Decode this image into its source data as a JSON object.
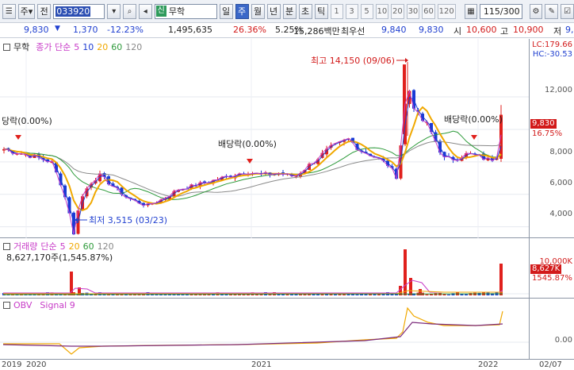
{
  "toolbar": {
    "menu_icon": "list-icon",
    "type_label": "주",
    "dropdown_label": "전",
    "code": "033920",
    "search_icon": "search-icon",
    "stock_badge": "신",
    "stock_name": "무학",
    "periods": [
      "일",
      "주",
      "월",
      "년",
      "분",
      "초",
      "틱"
    ],
    "active_period": "주",
    "numbers": [
      "1",
      "3",
      "5",
      "10",
      "20",
      "30",
      "60",
      "120"
    ],
    "count": "115/300"
  },
  "quote": {
    "price": "9,830",
    "change": "1,370",
    "change_pct": "-12.23%",
    "volume": "1,495,635",
    "vol_ratio": "26.36%",
    "turnover": "5.25%",
    "amount": "15,286백만",
    "priority_label": "최우선",
    "bid": "9,840",
    "ask": "9,830",
    "open_label": "시",
    "open": "10,600",
    "high_label": "고",
    "high": "10,900",
    "low_label": "저",
    "low": "9,"
  },
  "price_panel": {
    "stock_label": "무학",
    "legend_title": "종가 단순",
    "ma_periods": [
      "5",
      "10",
      "20",
      "60",
      "120"
    ],
    "ma_colors": [
      "#c83cc8",
      "#1e3cd2",
      "#f0a800",
      "#2d9a3a",
      "#888888"
    ],
    "lc": "LC:179.66",
    "hc": "HC:-30.53",
    "y_labels": [
      "12,000",
      "10,000",
      "8,000",
      "6,000",
      "4,000"
    ],
    "last_price_flag": "9,830",
    "last_pct_flag": "16.75%",
    "annotations": {
      "high": "최고 14,150 (09/06)",
      "low": "최저 3,515 (03/23)",
      "div1": "당락(0.00%)",
      "div2": "배당락(0.00%)",
      "div3": "배당락(0.00%)"
    }
  },
  "volume_panel": {
    "legend_title": "거래량",
    "legend_type": "단순",
    "ma_periods": [
      "5",
      "20",
      "60",
      "120"
    ],
    "last_volume": "8,627,170주(1,545.87%)",
    "y_label": "10,000K",
    "flag_volume": "8,627K",
    "flag_pct": "1545.87%"
  },
  "obv_panel": {
    "legend_title": "OBV",
    "signal_label": "Signal 9",
    "y_label": "0.00"
  },
  "x_axis": {
    "labels": [
      "2019",
      "2020",
      "2021",
      "2022",
      "02/07"
    ]
  },
  "chart_data": {
    "type": "candlestick",
    "title": "",
    "series": [
      {
        "name": "종가",
        "points": [
          [
            2019.85,
            8700
          ],
          [
            2020.0,
            8300
          ],
          [
            2020.15,
            7500
          ],
          [
            2020.22,
            3515
          ],
          [
            2020.35,
            6600
          ],
          [
            2020.5,
            5600
          ],
          [
            2020.7,
            5300
          ],
          [
            2020.9,
            6700
          ],
          [
            2021.1,
            7300
          ],
          [
            2021.3,
            7200
          ],
          [
            2021.45,
            9300
          ],
          [
            2021.6,
            8500
          ],
          [
            2021.68,
            14150
          ],
          [
            2021.8,
            10500
          ],
          [
            2021.95,
            8300
          ],
          [
            2022.1,
            8000
          ],
          [
            2022.1,
            9830
          ]
        ]
      }
    ],
    "ylim": [
      3000,
      14500
    ],
    "xlabel": "",
    "ylabel": ""
  }
}
